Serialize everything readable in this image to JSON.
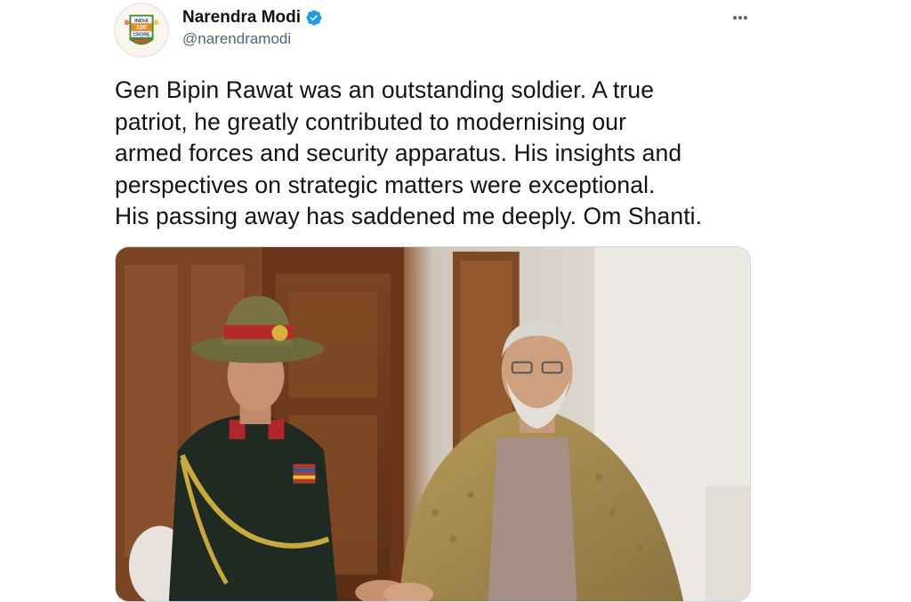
{
  "author": {
    "display_name": "Narendra Modi",
    "handle": "@narendramodi",
    "verified": true,
    "avatar_text_top": "INDIA",
    "avatar_text_mid": "100",
    "avatar_text_bottom": "CRORE"
  },
  "tweet": {
    "lines": [
      "Gen Bipin Rawat was an outstanding soldier. A true",
      "patriot, he greatly contributed to modernising our",
      "armed forces and security apparatus. His insights and",
      "perspectives on strategic matters were exceptional.",
      "His passing away has saddened me deeply. Om Shanti."
    ]
  },
  "colors": {
    "verified_badge": "#1d9bf0",
    "handle": "#536471",
    "text": "#0f1419"
  },
  "icons": {
    "verified": "verified-badge-icon",
    "more": "more-options-icon"
  }
}
